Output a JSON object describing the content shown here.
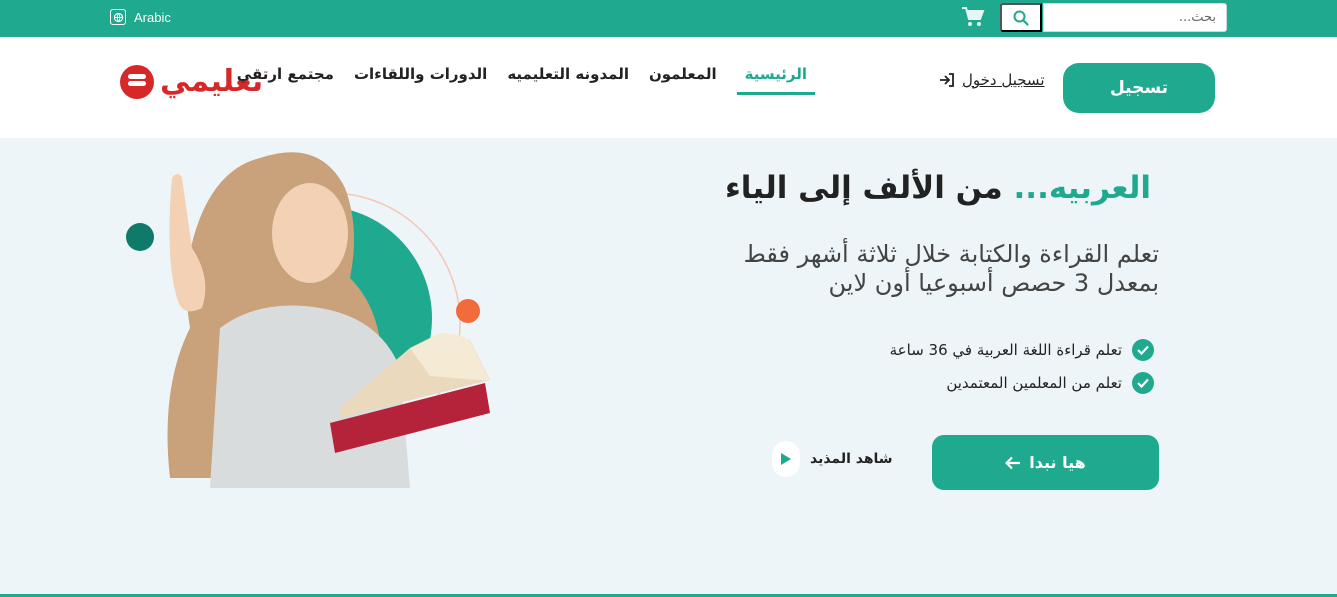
{
  "topbar": {
    "language": "Arabic",
    "search_placeholder": "بحث..."
  },
  "header": {
    "logo_text": "تعليمي",
    "nav": [
      {
        "label": "الرئيسية",
        "active": true
      },
      {
        "label": "المعلمون",
        "active": false
      },
      {
        "label": "المدونه التعليميه",
        "active": false
      },
      {
        "label": "الدورات واللقاءات",
        "active": false
      },
      {
        "label": "مجتمع ارتقي",
        "active": false
      }
    ],
    "login_label": "تسجيل دخول",
    "register_label": "تسجيل"
  },
  "hero": {
    "title_accent": "العربيه...",
    "title_rest": "من الألف إلى الياء",
    "subtitle": "تعلم القراءة والكتابة خلال ثلاثة أشهر فقط بمعدل 3 حصص أسبوعيا أون لاين",
    "features": [
      "تعلم قراءة اللغة العربية في 36 ساعة",
      "تعلم من المعلمين المعتمدين"
    ],
    "start_label": "هيا نبدا",
    "watch_label": "شاهد المذيد"
  },
  "colors": {
    "brand": "#1fa98f",
    "logo_red": "#d62828",
    "hero_bg": "#eef5f8",
    "accent_orange": "#f26b3a",
    "dark_teal": "#0f7a6a"
  },
  "icons": {
    "language": "globe-icon",
    "cart": "cart-icon",
    "search": "search-icon",
    "login": "login-arrow-icon",
    "check": "check-circle-icon",
    "start": "arrow-left-icon",
    "play": "play-icon"
  }
}
